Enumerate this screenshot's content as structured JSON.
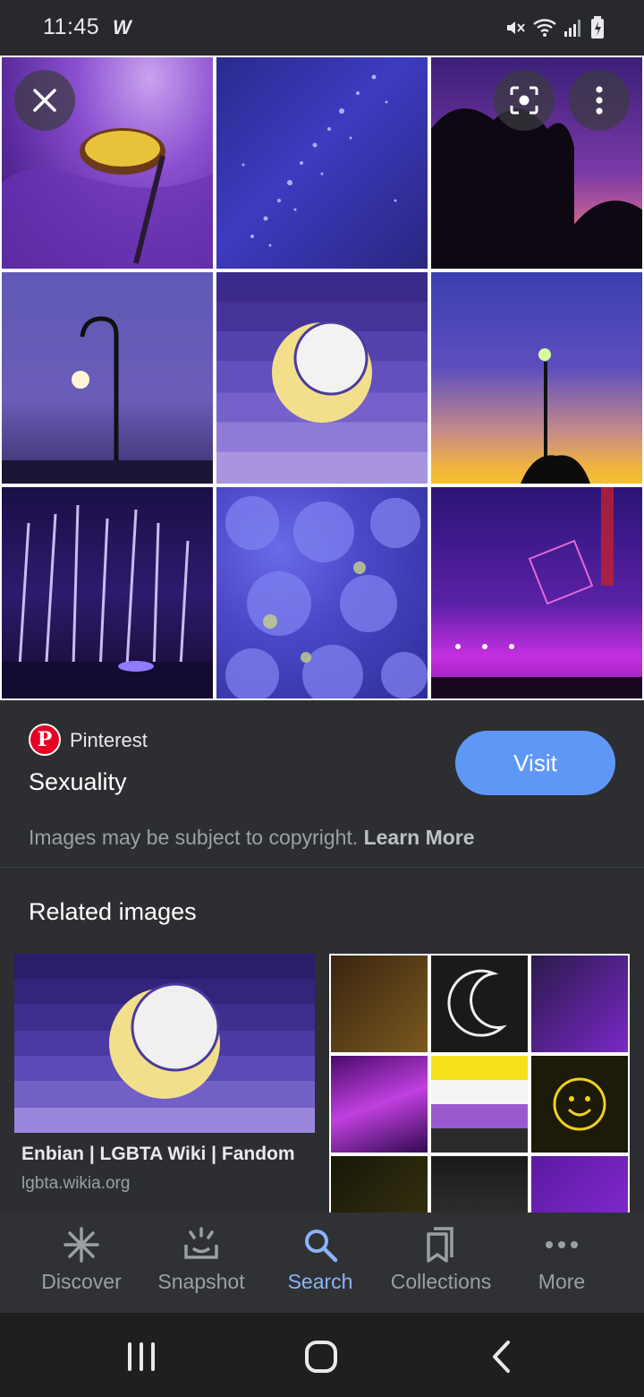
{
  "status_bar": {
    "time": "11:45",
    "app_glyph": "W"
  },
  "viewer": {
    "close_icon": "close-icon",
    "lens_icon": "lens-icon",
    "more_icon": "more-vert-icon"
  },
  "result": {
    "source": "Pinterest",
    "source_logo": "P",
    "title": "Sexuality",
    "visit_label": "Visit",
    "copyright_text": "Images may be subject to copyright.",
    "learn_more": "Learn More"
  },
  "related": {
    "heading": "Related images",
    "items": [
      {
        "title": "Enbian | LGBTA Wiki | Fandom",
        "domain": "lgbta.wikia.org"
      }
    ]
  },
  "bottom_nav": {
    "items": [
      {
        "label": "Discover",
        "icon": "asterisk-icon"
      },
      {
        "label": "Snapshot",
        "icon": "snapshot-icon"
      },
      {
        "label": "Search",
        "icon": "search-icon",
        "active": true
      },
      {
        "label": "Collections",
        "icon": "collections-icon"
      },
      {
        "label": "More",
        "icon": "more-horiz-icon"
      }
    ]
  },
  "colors": {
    "accent": "#8ab4f8",
    "visit_button": "#5e97f6",
    "background": "#202124"
  }
}
